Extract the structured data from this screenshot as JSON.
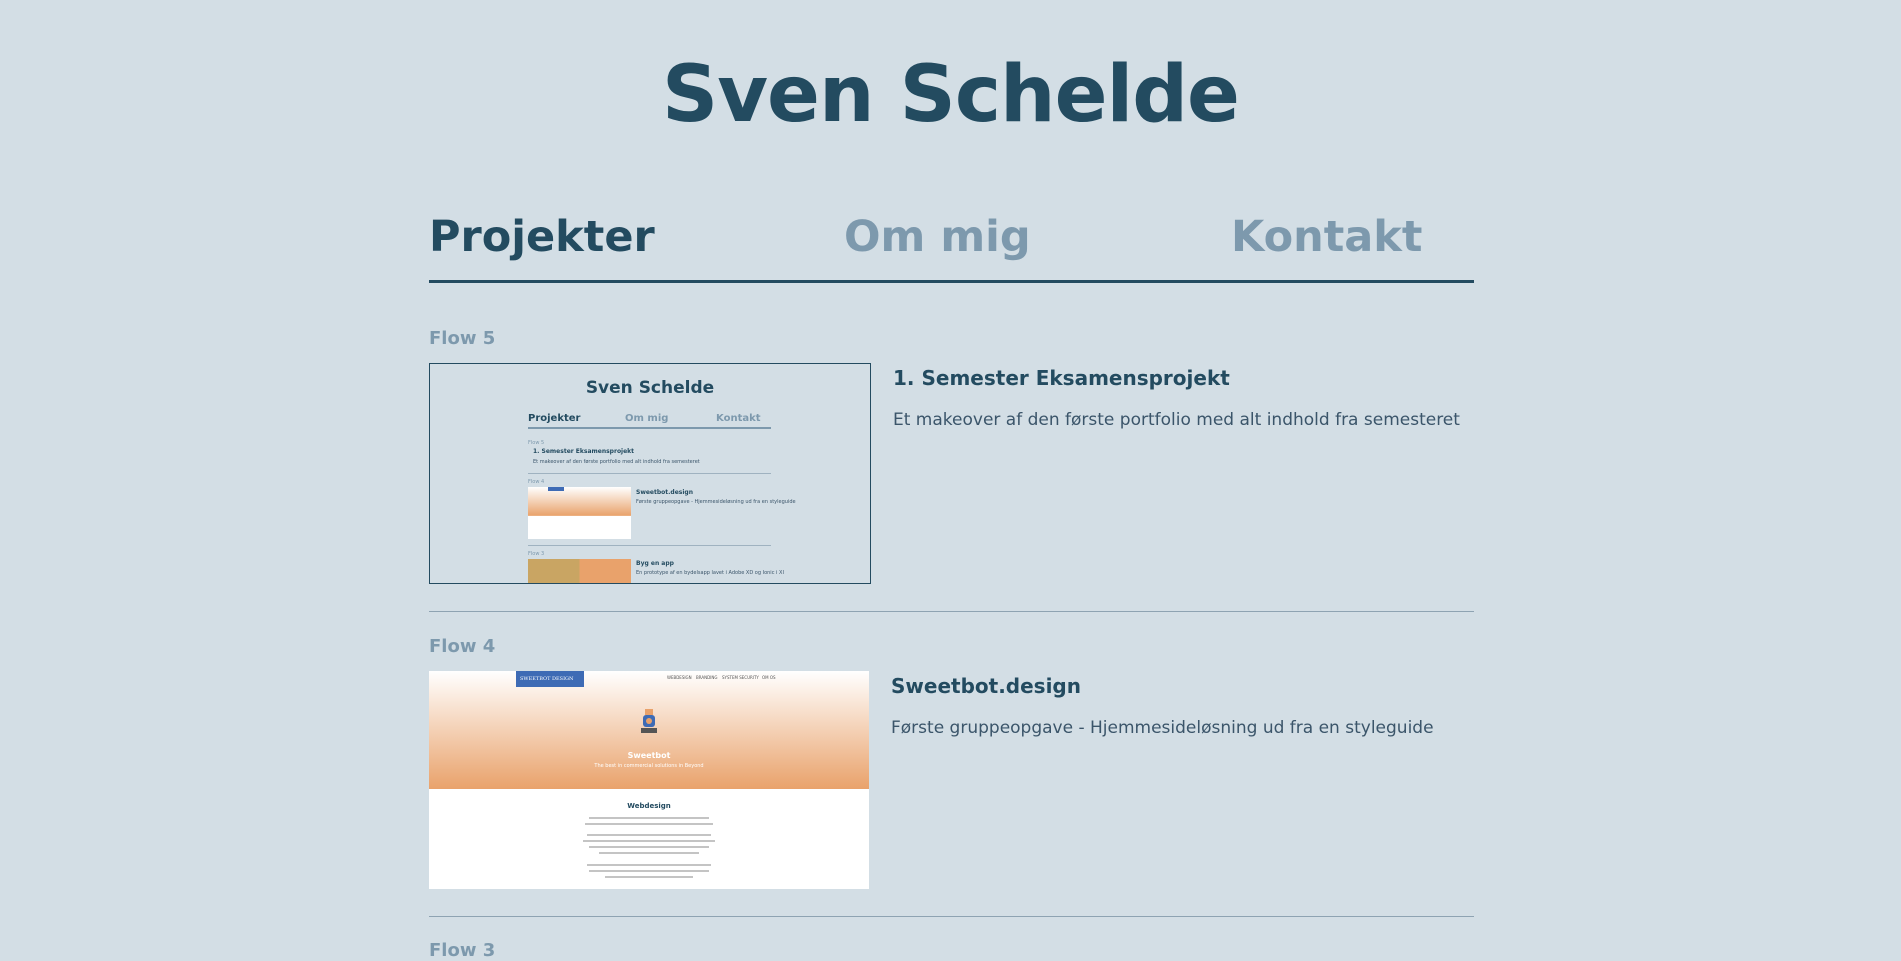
{
  "site": {
    "title": "Sven Schelde"
  },
  "nav": {
    "projects": "Projekter",
    "about": "Om mig",
    "contact": "Kontakt"
  },
  "projects": [
    {
      "flow": "Flow 5",
      "title": "1. Semester Eksamensprojekt",
      "description": "Et makeover af den første portfolio med alt indhold fra semesteret",
      "preview": {
        "site_title": "Sven Schelde",
        "nav": [
          "Projekter",
          "Om mig",
          "Kontakt"
        ],
        "flow5": "Flow 5",
        "title1": "1. Semester Eksamensprojekt",
        "desc1": "Et makeover af den første portfolio med alt indhold fra semesteret",
        "flow4": "Flow 4",
        "title2": "Sweetbot.design",
        "desc2": "Første gruppeopgave - Hjemmesideløsning ud fra en styleguide",
        "flow3": "Flow 3",
        "title3": "Byg en app",
        "desc3": "En prototype af en bydelsapp lavet i Adobe XD og Ionic i XI"
      }
    },
    {
      "flow": "Flow 4",
      "title": "Sweetbot.design",
      "description": "Første gruppeopgave - Hjemmesideløsning ud fra en styleguide",
      "preview": {
        "brand": "SWEETBOT DESIGN",
        "nav": [
          "WEBDESIGN",
          "BRANDING",
          "SYSTEM SECURITY",
          "OM OS"
        ],
        "name": "Sweetbot",
        "tagline": "The best in commercial solutions in Beyond",
        "heading": "Webdesign"
      }
    }
  ],
  "next_flow": "Flow 3",
  "colors": {
    "background": "#d3dee5",
    "primary": "#234b60",
    "muted": "#7d99ad",
    "accent_orange": "#e9a26b",
    "accent_blue": "#3e6bb5"
  }
}
